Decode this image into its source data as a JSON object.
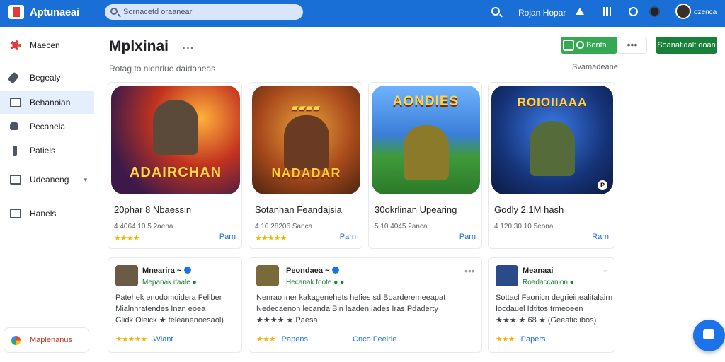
{
  "topbar": {
    "logo_text": "Aptunaeai",
    "search_placeholder": "Sornacetd oraaneari",
    "link": "Rojan Hopar",
    "user": "ozenca"
  },
  "sidebar": {
    "items": [
      {
        "label": "Maecen",
        "icon": "brand-icon"
      },
      {
        "label": "Begealy",
        "icon": "wrench-icon"
      },
      {
        "label": "Behanoian",
        "icon": "monitor-icon"
      },
      {
        "label": "Pecanela",
        "icon": "person-icon"
      },
      {
        "label": "Patiels",
        "icon": "pin-icon"
      },
      {
        "label": "Udeaneng",
        "icon": "mail-icon",
        "chevron": "▾"
      },
      {
        "label": "Hanels",
        "icon": "mail-icon"
      }
    ],
    "bottom_label": "Maplenanus"
  },
  "main": {
    "title": "Mplxinai",
    "title_dots": "▪ ▪ ▪",
    "subtitle": "Rotag to nlonrlue daidaneas",
    "see_more": "Svamadeane",
    "toggle_label": "Bonta",
    "more_label": "•••",
    "primary_button": "Soanatidalt ooan"
  },
  "cards": [
    {
      "banner": "ADAIRCHAN",
      "title": "20phar 8 Nbaessin",
      "meta": "4 4064 10 5 2aena",
      "stars": "★★★★",
      "link": "Parn",
      "badge": ""
    },
    {
      "banner": "NADADAR",
      "title": "Sotanhan Feandajsia",
      "meta": "4 10 28206 Sanca",
      "stars": "★★★★★",
      "link": "Parn",
      "badge": ""
    },
    {
      "banner": "AONDIES",
      "title": "30okrlinan Upearing",
      "meta": "5 10 4045 2anca",
      "stars": "",
      "link": "Parn",
      "badge": ""
    },
    {
      "banner": "ROIOIIAAA",
      "title": "Godly 2.1M hash",
      "meta": "4 120 30 10 5eona",
      "stars": "",
      "link": "Rarn",
      "badge": "P"
    }
  ],
  "reviews": [
    {
      "name": "Mnearira ~",
      "sub": "Mepanak ifaale ●",
      "body": [
        "Patehek enodomoidera Feliber",
        "Mialnhratendes Inan eoea",
        "Glidk Oleick ★ teleanenoesaol)"
      ],
      "stars": "★★★★★",
      "action": "Wiant",
      "action2": ""
    },
    {
      "name": "Peondaea ~",
      "sub": "Hecanak foote ● ●",
      "body": [
        "Nenrao iner kakagenehets hefies sd Boarderemeeapat",
        "Nedecaenon lecanda Bin laaden iades Iras Pdaderty",
        "★★★★ ★ Paesa"
      ],
      "stars": "★★★",
      "action": "Papens",
      "action2": "Cnco Feelrle"
    },
    {
      "name": "Meanaai",
      "sub": "Roadaccanion ●",
      "body": [
        "Sottacl Faonicn degrieinealitalairn",
        "Iocdauel Idtitos trmeoeen",
        "★★★ ★ 68 ★ (Geeatic ibos)"
      ],
      "stars": "★★★",
      "action": "Papers",
      "action2": ""
    }
  ]
}
